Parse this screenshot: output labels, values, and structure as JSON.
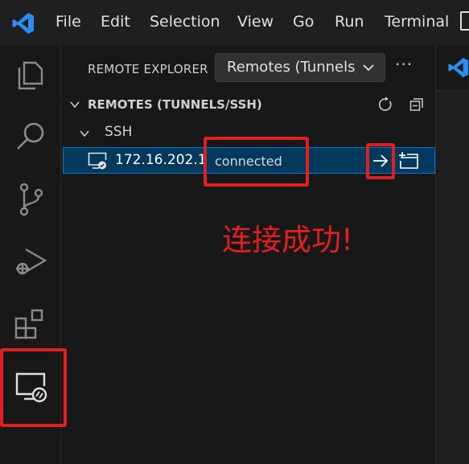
{
  "menu": [
    "File",
    "Edit",
    "Selection",
    "View",
    "Go",
    "Run",
    "Terminal"
  ],
  "activity_bar": [
    "explorer-icon",
    "search-icon",
    "source-control-icon",
    "run-debug-icon",
    "extensions-icon",
    "remote-explorer-icon"
  ],
  "sidebar": {
    "title": "REMOTE EXPLORER",
    "dropdown_value": "Remotes (Tunnels/SSH)",
    "more": "···",
    "section_title": "REMOTES (TUNNELS/SSH)",
    "group": "SSH",
    "host": {
      "label": "172.16.202.1",
      "description": "connected"
    }
  },
  "annotation": {
    "text": "连接成功!",
    "color": "#e02020"
  },
  "colors": {
    "accent": "#0078d4",
    "selection": "#04395e",
    "vscode_blue": "#2d8cf0"
  }
}
